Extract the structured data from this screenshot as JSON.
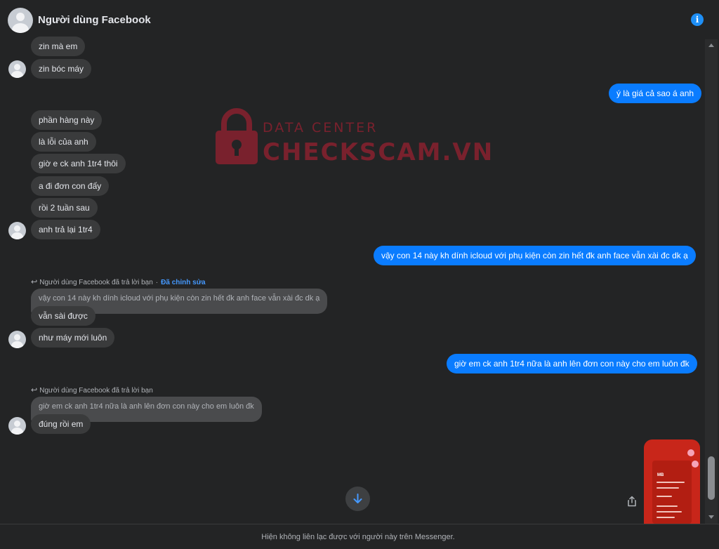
{
  "header": {
    "contact_name": "Người dùng Facebook"
  },
  "messages": {
    "m1": "zin mà em",
    "m2": "zin bóc máy",
    "m3": "ý là giá cả sao á anh",
    "m4": "phần hàng này",
    "m5": "là lỗi của anh",
    "m6": "giờ e ck anh 1tr4 thôi",
    "m7": "a đi đơn con đấy",
    "m8": "rồi 2 tuần sau",
    "m9": "anh trả lại 1tr4",
    "m10": "vậy con 14 này kh dính icloud với phụ kiện còn zin hết đk anh face vẫn xài đc dk ạ",
    "m11": "vẫn sài được",
    "m12": "như máy mới luôn",
    "m13": "giờ em ck anh 1tr4 nữa là anh lên đơn con này cho em luôn đk",
    "m14": "đúng rồi em"
  },
  "replies": {
    "r1_meta": "Người dùng Facebook đã trả lời bạn",
    "r1_edited": "Đã chỉnh sửa",
    "r1_quote": "vậy con 14 này kh dính icloud với phụ kiện còn zin hết đk anh face vẫn xài đc dk ạ",
    "r2_meta": "Người dùng Facebook đã trả lời bạn",
    "r2_quote": "giờ em ck anh 1tr4 nữa là anh lên đơn con này cho em luôn đk"
  },
  "watermark": {
    "line1": "DATA CENTER",
    "line2": "CHECKSCAM.VN"
  },
  "image_message": {
    "bank_label": "MB"
  },
  "footer": {
    "notice": "Hiện không liên lạc được với người này trên Messenger."
  },
  "colors": {
    "incoming": "#3a3b3c",
    "outgoing": "#0a7cff",
    "accent": "#1e8ff6",
    "background": "#232425"
  },
  "icons": [
    "info-icon",
    "reply-arrow-icon",
    "scroll-down-arrow-icon",
    "share-icon",
    "padlock-icon"
  ]
}
